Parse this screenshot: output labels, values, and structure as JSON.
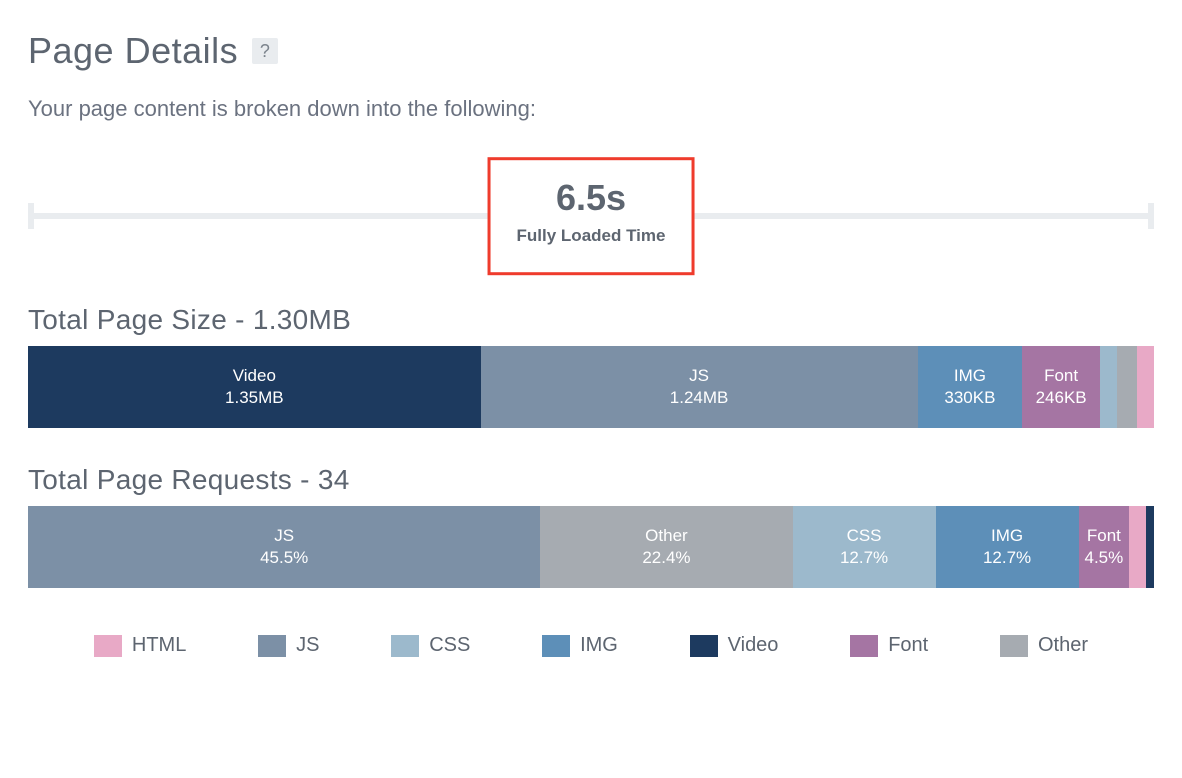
{
  "title": "Page Details",
  "help_icon": "?",
  "subtitle": "Your page content is broken down into the following:",
  "load_time": {
    "value": "6.5s",
    "label": "Fully Loaded Time"
  },
  "colors": {
    "HTML": "#e8a9c6",
    "JS": "#7c90a6",
    "CSS": "#9cb9cc",
    "IMG": "#5d8fb8",
    "Video": "#1d3a5f",
    "Font": "#a575a3",
    "Other": "#a6abb1"
  },
  "size_section": {
    "title": "Total Page Size - 1.30MB",
    "segments": [
      {
        "name": "Video",
        "value": "1.35MB",
        "weight": 40.2,
        "colorKey": "Video"
      },
      {
        "name": "JS",
        "value": "1.24MB",
        "weight": 38.8,
        "colorKey": "JS"
      },
      {
        "name": "IMG",
        "value": "330KB",
        "weight": 9.3,
        "colorKey": "IMG"
      },
      {
        "name": "Font",
        "value": "246KB",
        "weight": 6.9,
        "colorKey": "Font"
      },
      {
        "name": "CSS",
        "value": "",
        "weight": 1.5,
        "colorKey": "CSS"
      },
      {
        "name": "Other",
        "value": "",
        "weight": 1.8,
        "colorKey": "Other"
      },
      {
        "name": "HTML",
        "value": "",
        "weight": 1.5,
        "colorKey": "HTML"
      }
    ]
  },
  "requests_section": {
    "title": "Total Page Requests -  34",
    "segments": [
      {
        "name": "JS",
        "value": "45.5%",
        "weight": 45.5,
        "colorKey": "JS"
      },
      {
        "name": "Other",
        "value": "22.4%",
        "weight": 22.4,
        "colorKey": "Other"
      },
      {
        "name": "CSS",
        "value": "12.7%",
        "weight": 12.7,
        "colorKey": "CSS"
      },
      {
        "name": "IMG",
        "value": "12.7%",
        "weight": 12.7,
        "colorKey": "IMG"
      },
      {
        "name": "Font",
        "value": "4.5%",
        "weight": 4.5,
        "colorKey": "Font"
      },
      {
        "name": "HTML",
        "value": "",
        "weight": 1.5,
        "colorKey": "HTML"
      },
      {
        "name": "Video",
        "value": "",
        "weight": 0.7,
        "colorKey": "Video"
      }
    ]
  },
  "legend": [
    "HTML",
    "JS",
    "CSS",
    "IMG",
    "Video",
    "Font",
    "Other"
  ],
  "chart_data": [
    {
      "type": "bar",
      "title": "Total Page Size - 1.30MB",
      "orientation": "single-stacked-horizontal",
      "unit": "bytes",
      "series": [
        {
          "name": "Video",
          "value": "1.35MB"
        },
        {
          "name": "JS",
          "value": "1.24MB"
        },
        {
          "name": "IMG",
          "value": "330KB"
        },
        {
          "name": "Font",
          "value": "246KB"
        }
      ],
      "annotations": [
        "Fully Loaded Time 6.5s"
      ]
    },
    {
      "type": "bar",
      "title": "Total Page Requests - 34",
      "orientation": "single-stacked-horizontal",
      "unit": "percent",
      "series": [
        {
          "name": "JS",
          "value": 45.5
        },
        {
          "name": "Other",
          "value": 22.4
        },
        {
          "name": "CSS",
          "value": 12.7
        },
        {
          "name": "IMG",
          "value": 12.7
        },
        {
          "name": "Font",
          "value": 4.5
        }
      ]
    }
  ]
}
